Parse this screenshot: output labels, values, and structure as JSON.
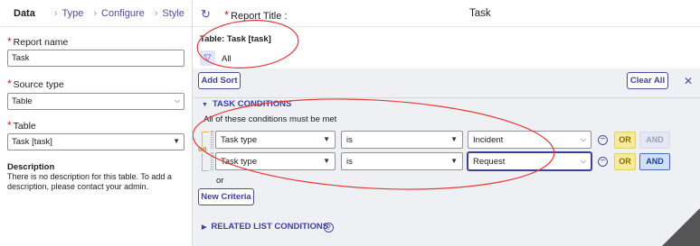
{
  "left_panel": {
    "tabs": [
      {
        "label": "Data",
        "active": true
      },
      {
        "label": "Type",
        "active": false
      },
      {
        "label": "Configure",
        "active": false
      },
      {
        "label": "Style",
        "active": false
      }
    ],
    "report_name_label": "Report name",
    "report_name_value": "Task",
    "source_type_label": "Source type",
    "source_type_value": "Table",
    "table_label": "Table",
    "table_value": "Task [task]",
    "description_title": "Description",
    "description_text": "There is no description for this table. To add a description, please contact your admin."
  },
  "right_panel": {
    "report_title_label": "Report Title :",
    "report_title_value": "Task",
    "table_info": "Table: Task [task]",
    "filter_label": "All",
    "add_sort": "Add Sort",
    "clear_all": "Clear All",
    "task_conditions_header": "TASK CONDITIONS",
    "conditions_subtitle": "All of these conditions must be met",
    "or_group_label": "OR",
    "conditions": [
      {
        "field": "Task type",
        "operator": "is",
        "value": "Incident",
        "or_label": "OR",
        "and_label": "AND",
        "and_active": false
      },
      {
        "field": "Task type",
        "operator": "is",
        "value": "Request",
        "or_label": "OR",
        "and_label": "AND",
        "and_active": true
      }
    ],
    "or_text": "or",
    "new_criteria": "New Criteria",
    "related_list_header": "RELATED LIST CONDITIONS"
  },
  "colors": {
    "accent": "#3d409c",
    "required": "#d0211c",
    "or_button": "#f5eb9c",
    "annotation": "#e53935"
  },
  "icons": [
    "refresh-icon",
    "filter-icon",
    "close-icon",
    "remove-condition-icon",
    "help-icon",
    "chevron-down-icon"
  ]
}
